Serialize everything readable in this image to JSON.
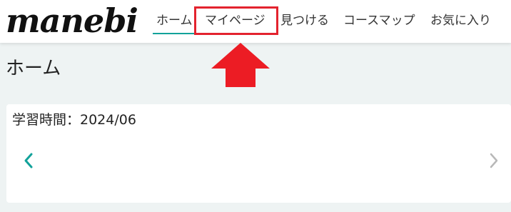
{
  "header": {
    "logo_text": "manebi",
    "nav": [
      {
        "label": "ホーム",
        "active": true
      },
      {
        "label": "マイページ",
        "highlighted": true
      },
      {
        "label": "見つける"
      },
      {
        "label": "コースマップ"
      },
      {
        "label": "お気に入り"
      }
    ]
  },
  "main": {
    "title": "ホーム",
    "card": {
      "title": "学習時間：2024/06",
      "prev_icon": "chevron-left-icon",
      "next_icon": "chevron-right-icon"
    }
  },
  "colors": {
    "accent": "#12a29a",
    "highlight": "#e3232e",
    "arrow": "#ec1c24",
    "background": "#eef3f3"
  }
}
